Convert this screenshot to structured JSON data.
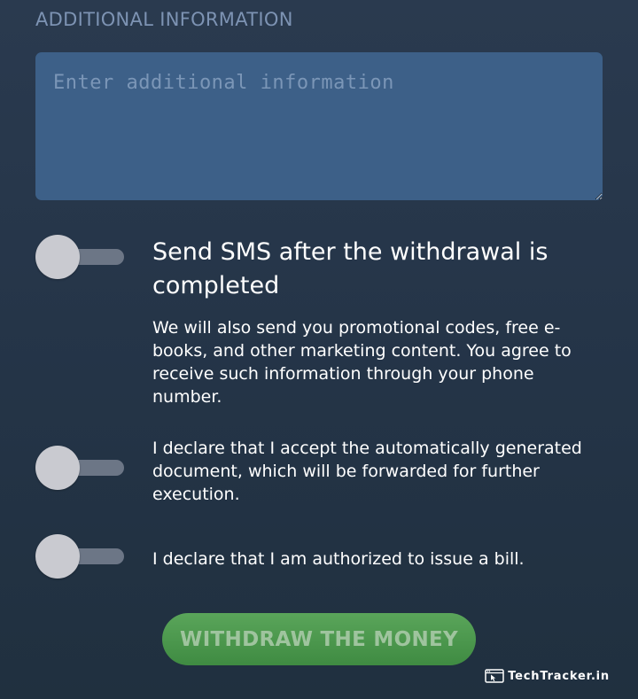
{
  "additional_info": {
    "section_label": "ADDITIONAL INFORMATION",
    "placeholder": "Enter additional information",
    "value": ""
  },
  "consents": [
    {
      "heading": "Send SMS after the withdrawal is completed",
      "text": "We will also send you promotional codes, free e-books, and other marketing content. You agree to receive such information through your phone number.",
      "enabled": false
    },
    {
      "text": "I declare that I accept the automatically generated document, which will be forwarded for further execution.",
      "enabled": false
    },
    {
      "text": "I declare that I am authorized to issue a bill.",
      "enabled": false
    }
  ],
  "actions": {
    "withdraw_label": "WITHDRAW THE MONEY"
  },
  "watermark": {
    "text": "TechTracker.in",
    "icon": "browser-cursor-icon"
  },
  "colors": {
    "background": "#243447",
    "textarea": "#3d6088",
    "label": "#7d93b3",
    "toggle_knob": "#c9cad0",
    "toggle_track": "#6c7686",
    "button_green": "#4a984d"
  }
}
